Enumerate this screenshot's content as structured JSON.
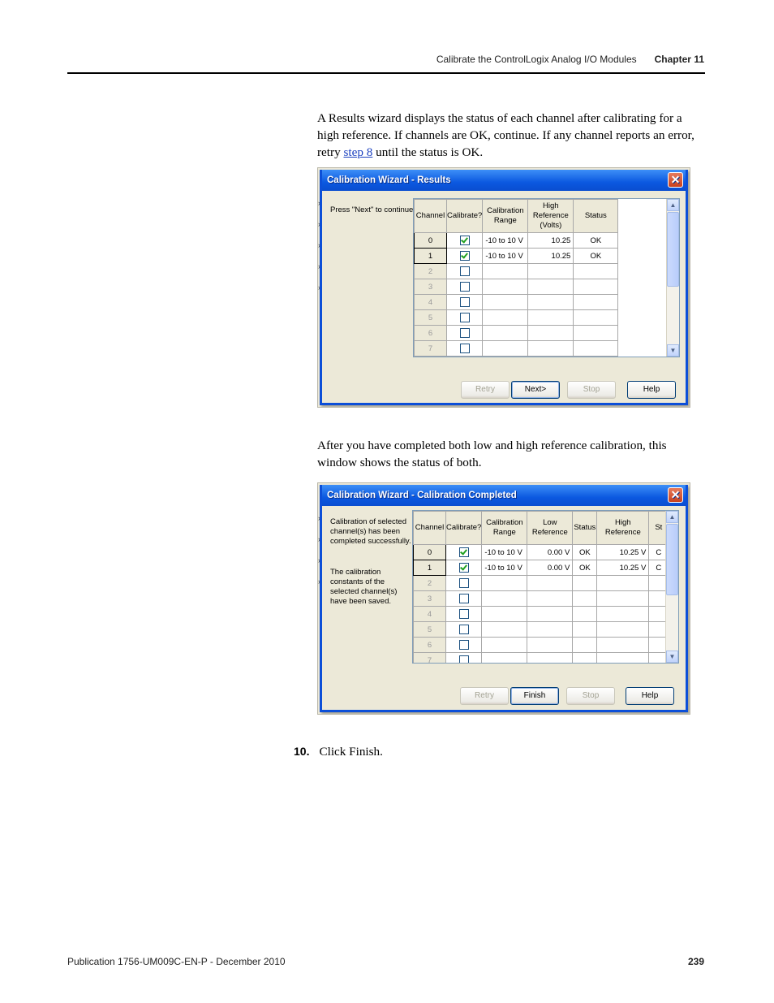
{
  "header": {
    "section": "Calibrate the ControlLogix Analog I/O Modules",
    "chapter": "Chapter 11"
  },
  "paragraph1": {
    "before_link": "A Results wizard displays the status of each channel after calibrating for a high reference. If channels are OK, continue. If any channel reports an error, retry ",
    "link": "step 8",
    "after_link": " until the status is OK."
  },
  "dialog1": {
    "title": "Calibration Wizard - Results",
    "message": "Press \"Next\" to continue.",
    "columns": [
      "Channel",
      "Calibrate?",
      "Calibration Range",
      "High Reference (Volts)",
      "Status"
    ],
    "rows": [
      {
        "channel": "0",
        "checked": true,
        "range": "-10 to 10 V",
        "high": "10.25",
        "status": "OK"
      },
      {
        "channel": "1",
        "checked": true,
        "range": "-10 to 10 V",
        "high": "10.25",
        "status": "OK"
      },
      {
        "channel": "2",
        "checked": false,
        "range": "",
        "high": "",
        "status": ""
      },
      {
        "channel": "3",
        "checked": false,
        "range": "",
        "high": "",
        "status": ""
      },
      {
        "channel": "4",
        "checked": false,
        "range": "",
        "high": "",
        "status": ""
      },
      {
        "channel": "5",
        "checked": false,
        "range": "",
        "high": "",
        "status": ""
      },
      {
        "channel": "6",
        "checked": false,
        "range": "",
        "high": "",
        "status": ""
      },
      {
        "channel": "7",
        "checked": false,
        "range": "",
        "high": "",
        "status": ""
      }
    ],
    "buttons": {
      "retry": "Retry",
      "next": "Next>",
      "stop": "Stop",
      "help": "Help"
    }
  },
  "paragraph2": "After you have completed both low and high reference calibration, this window shows the status of both.",
  "dialog2": {
    "title": "Calibration Wizard - Calibration Completed",
    "message1": "Calibration of selected channel(s) has been completed successfully.",
    "message2": "The calibration constants of the selected channel(s) have been saved.",
    "columns": [
      "Channel",
      "Calibrate?",
      "Calibration Range",
      "Low Reference",
      "Status",
      "High Reference",
      "St"
    ],
    "rows": [
      {
        "channel": "0",
        "checked": true,
        "range": "-10 to 10 V",
        "low": "0.00 V",
        "status": "OK",
        "high": "10.25 V",
        "st": "C"
      },
      {
        "channel": "1",
        "checked": true,
        "range": "-10 to 10 V",
        "low": "0.00 V",
        "status": "OK",
        "high": "10.25 V",
        "st": "C"
      },
      {
        "channel": "2",
        "checked": false,
        "range": "",
        "low": "",
        "status": "",
        "high": "",
        "st": ""
      },
      {
        "channel": "3",
        "checked": false,
        "range": "",
        "low": "",
        "status": "",
        "high": "",
        "st": ""
      },
      {
        "channel": "4",
        "checked": false,
        "range": "",
        "low": "",
        "status": "",
        "high": "",
        "st": ""
      },
      {
        "channel": "5",
        "checked": false,
        "range": "",
        "low": "",
        "status": "",
        "high": "",
        "st": ""
      },
      {
        "channel": "6",
        "checked": false,
        "range": "",
        "low": "",
        "status": "",
        "high": "",
        "st": ""
      },
      {
        "channel": "7",
        "checked": false,
        "range": "",
        "low": "",
        "status": "",
        "high": "",
        "st": ""
      }
    ],
    "buttons": {
      "retry": "Retry",
      "finish": "Finish",
      "stop": "Stop",
      "help": "Help"
    }
  },
  "step10": {
    "number": "10.",
    "text": "Click Finish."
  },
  "footer": {
    "publication": "Publication 1756-UM009C-EN-P - December 2010",
    "page": "239"
  }
}
